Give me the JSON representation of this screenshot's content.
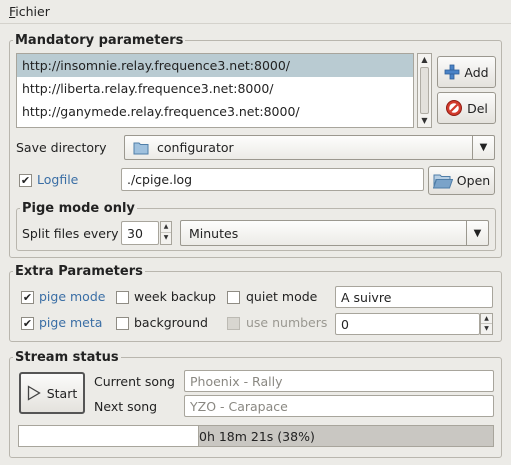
{
  "menubar": {
    "fichier_mnemonic": "F",
    "fichier_rest": "ichier"
  },
  "mandatory": {
    "title": "Mandatory parameters",
    "urls": [
      "http://insomnie.relay.frequence3.net:8000/",
      "http://liberta.relay.frequence3.net:8000/",
      "http://ganymede.relay.frequence3.net:8000/"
    ],
    "selected_index": 0,
    "add_label": "Add",
    "del_label": "Del",
    "save_directory_label": "Save directory",
    "save_directory_value": "configurator",
    "logfile_label": "Logfile",
    "logfile_checked": true,
    "logfile_value": "./cpige.log",
    "open_label": "Open"
  },
  "pige_mode": {
    "title": "Pige mode only",
    "split_label": "Split files every",
    "split_value": "30",
    "unit_value": "Minutes"
  },
  "extra": {
    "title": "Extra Parameters",
    "pige_mode_label": "pige mode",
    "pige_mode_checked": true,
    "week_backup_label": "week backup",
    "week_backup_checked": false,
    "quiet_mode_label": "quiet mode",
    "quiet_mode_checked": false,
    "text_value": "A suivre",
    "pige_meta_label": "pige meta",
    "pige_meta_checked": true,
    "background_label": "background",
    "background_checked": false,
    "use_numbers_label": "use numbers",
    "use_numbers_checked": false,
    "use_numbers_enabled": false,
    "number_value": "0"
  },
  "status": {
    "title": "Stream status",
    "start_label": "Start",
    "current_song_label": "Current song",
    "current_song_value": "Phoenix - Rally",
    "next_song_label": "Next song",
    "next_song_value": "YZO - Carapace",
    "progress_text": "0h 18m 21s (38%)",
    "progress_fraction": 0.38
  },
  "icons": {
    "add": "plus-icon",
    "del": "no-entry-icon",
    "folder": "folder-icon",
    "open": "open-folder-icon",
    "start": "play-icon"
  },
  "colors": {
    "selection": "#b9cbd2",
    "link_blue": "#3a6ea5",
    "background": "#ecebe7"
  }
}
